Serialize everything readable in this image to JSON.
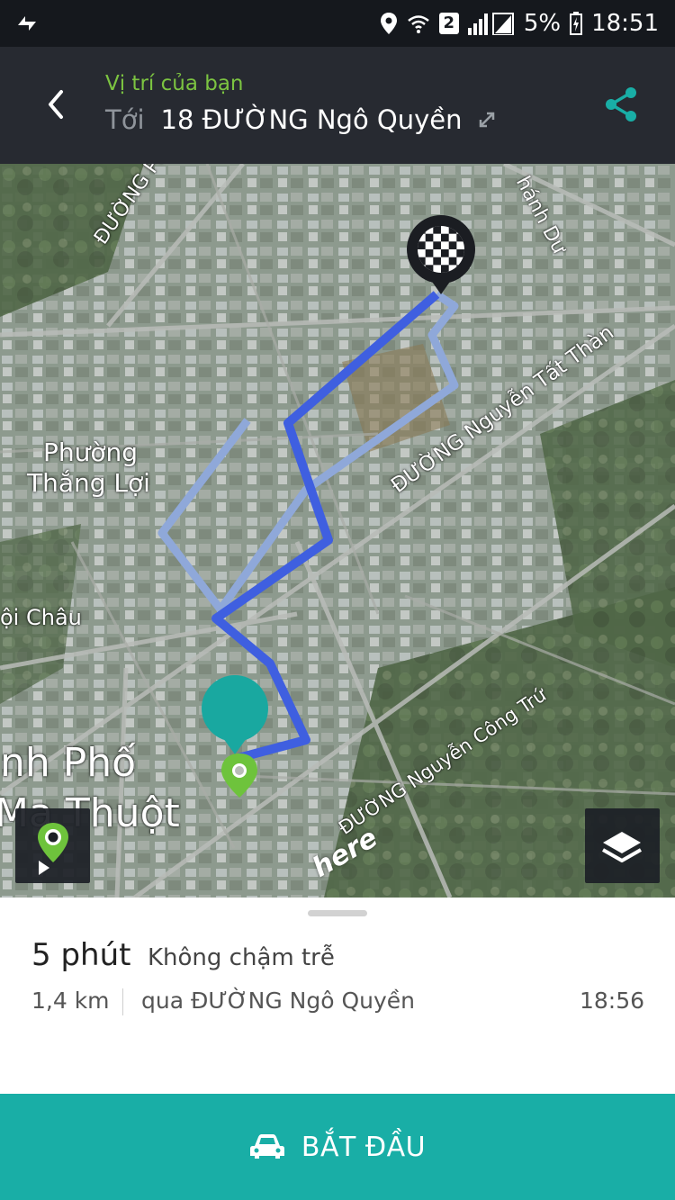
{
  "status_bar": {
    "sim": "2",
    "battery": "5%",
    "time": "18:51"
  },
  "header": {
    "from_label": "Vị trí của bạn",
    "to_prefix": "Tới",
    "destination": "18 ĐƯỜNG Ngô Quyền"
  },
  "map": {
    "labels": {
      "phan": "ĐƯỜNG Phan C",
      "nhanh_du": "hánh Dư",
      "nguyen_tat_thanh": "ĐƯỜNG Nguyễn Tất Thàn",
      "phuong_line1": "Phường",
      "phuong_line2": "Thắng Lợi",
      "loi_chau": "ội Châu",
      "nguyen_cong_tru": "ĐƯỜNG Nguyễn Công Trứ",
      "city_line1": "nh Phố",
      "city_line2": "Ma Thuột",
      "here": "here"
    }
  },
  "route_summary": {
    "duration": "5 phút",
    "traffic": "Không chậm trễ",
    "distance": "1,4 km",
    "via": "qua ĐƯỜNG Ngô Quyền",
    "eta": "18:56"
  },
  "start_button": {
    "label": "BẮT ĐẦU"
  },
  "colors": {
    "accent": "#19aea6",
    "route_primary": "#3f5fe0",
    "route_alt": "#8fa8d9",
    "from_label": "#7cc441"
  }
}
